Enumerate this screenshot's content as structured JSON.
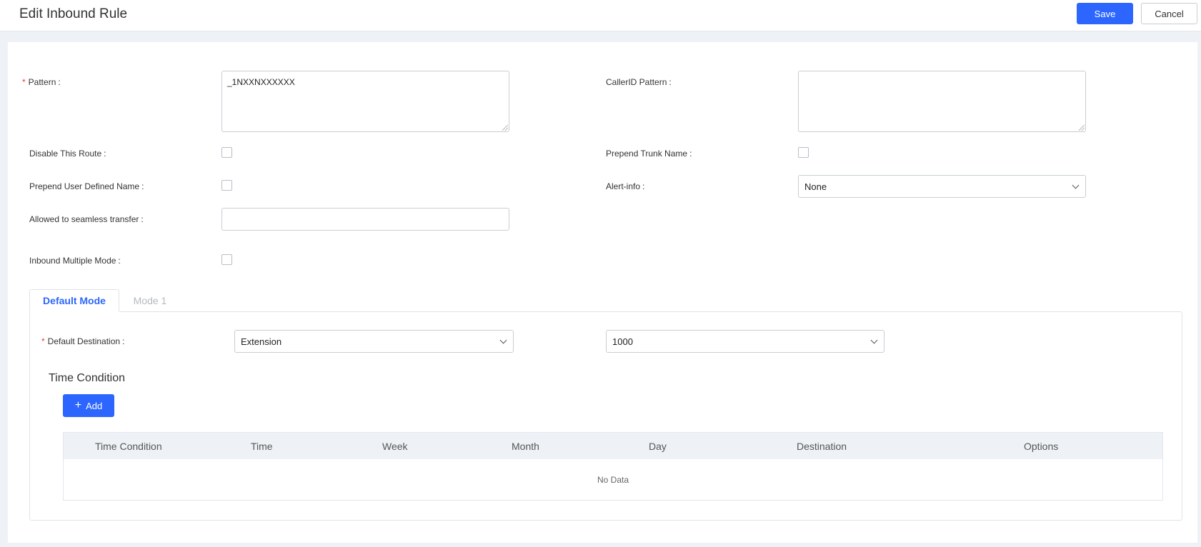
{
  "header": {
    "title": "Edit Inbound Rule",
    "save_label": "Save",
    "cancel_label": "Cancel"
  },
  "form": {
    "required_mark": "*",
    "colon": ":",
    "pattern": {
      "label": "Pattern",
      "value": "_1NXXNXXXXXX"
    },
    "callerid_pattern": {
      "label": "CallerID Pattern",
      "value": ""
    },
    "disable_route": {
      "label": "Disable This Route",
      "checked": false
    },
    "prepend_trunk_name": {
      "label": "Prepend Trunk Name",
      "checked": false
    },
    "prepend_user_defined_name": {
      "label": "Prepend User Defined Name",
      "checked": false
    },
    "alert_info": {
      "label": "Alert-info",
      "value": "None"
    },
    "seamless_transfer": {
      "label": "Allowed to seamless transfer",
      "value": ""
    },
    "inbound_multiple_mode": {
      "label": "Inbound Multiple Mode",
      "checked": false
    }
  },
  "tabs": [
    {
      "label": "Default Mode",
      "active": true
    },
    {
      "label": "Mode 1",
      "active": false
    }
  ],
  "default_mode": {
    "destination_label": "Default Destination",
    "destination_type": "Extension",
    "destination_value": "1000"
  },
  "time_condition": {
    "title": "Time Condition",
    "add_label": "Add",
    "columns": [
      "Time Condition",
      "Time",
      "Week",
      "Month",
      "Day",
      "Destination",
      "Options"
    ],
    "empty_text": "No Data"
  },
  "colors": {
    "primary": "#2c66ff",
    "required": "#e83d3d"
  }
}
